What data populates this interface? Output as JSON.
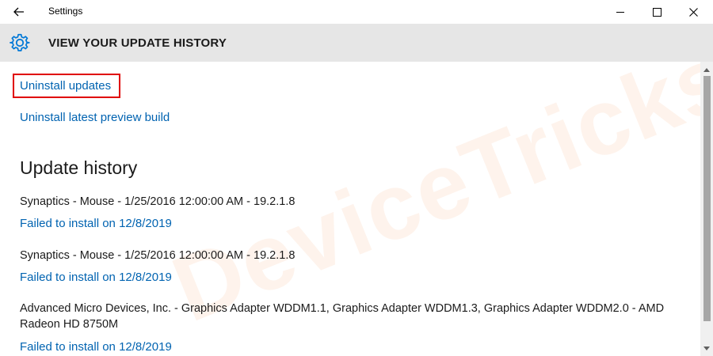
{
  "window": {
    "title": "Settings",
    "back_icon": "back-arrow-icon",
    "controls": [
      "minimize-icon",
      "maximize-icon",
      "close-icon"
    ]
  },
  "header": {
    "icon": "gear-icon",
    "title": "VIEW YOUR UPDATE HISTORY",
    "background": "#e6e6e6"
  },
  "links": {
    "uninstall_updates": "Uninstall updates",
    "uninstall_preview": "Uninstall latest preview build"
  },
  "history": {
    "title": "Update history",
    "entries": [
      {
        "name": "Synaptics - Mouse - 1/25/2016 12:00:00 AM - 19.2.1.8",
        "status": "Failed to install on 12/8/2019"
      },
      {
        "name": "Synaptics - Mouse - 1/25/2016 12:00:00 AM - 19.2.1.8",
        "status": "Failed to install on 12/8/2019"
      },
      {
        "name": "Advanced Micro Devices, Inc. - Graphics Adapter WDDM1.1, Graphics Adapter WDDM1.3, Graphics Adapter WDDM2.0 - AMD Radeon HD 8750M",
        "status": "Failed to install on 12/8/2019"
      }
    ]
  },
  "watermark": {
    "text": "DeviceTricks"
  },
  "colors": {
    "link": "#0063b1",
    "highlight": "#e00000",
    "accent_icon": "#0078d7"
  }
}
